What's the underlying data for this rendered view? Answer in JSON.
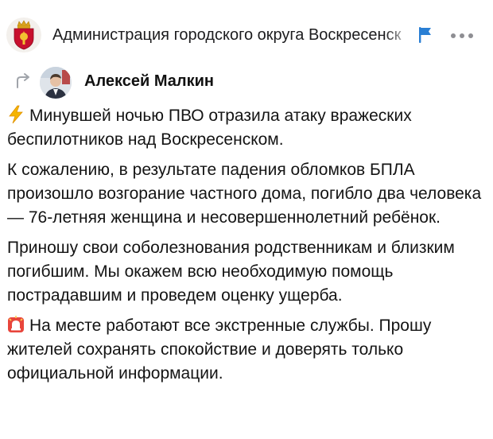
{
  "header": {
    "channel_title": "Администрация городского округа Воскресенск",
    "channel_avatar_icon": "coat-of-arms-icon",
    "flag_icon": "flag-icon",
    "more_icon": "more-dots-icon",
    "flag_color": "#2a7fd4"
  },
  "repost": {
    "repost_icon": "repost-arrow-icon",
    "author_name": "Алексей Малкин",
    "author_avatar": "author-photo"
  },
  "post": {
    "paragraphs": [
      {
        "icon": "lightning-icon",
        "text": "Минувшей ночью ПВО отразила атаку вражеских беспилотников над Воскресенском."
      },
      {
        "icon": "",
        "text": "К сожалению, в результате падения обломков БПЛА произошло возгорание частного дома, погибло два человека — 76-летняя женщина и несовершеннолетний ребёнок."
      },
      {
        "icon": "",
        "text": "Приношу свои соболезнования родственникам и близким погибшим. Мы окажем всю необходимую помощь пострадавшим и проведем оценку ущерба."
      },
      {
        "icon": "siren-icon",
        "text": "На месте работают все экстренные службы. Прошу жителей сохранять спокойствие и доверять только официальной информации."
      }
    ]
  }
}
